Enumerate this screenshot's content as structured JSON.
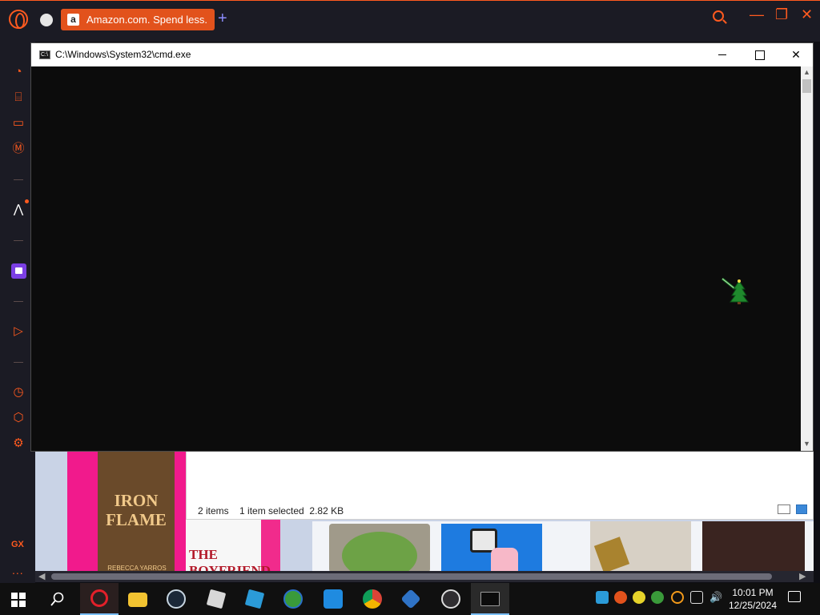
{
  "browser": {
    "tab_title": "Amazon.com. Spend less.",
    "tab_favicon": "a",
    "new_tab_label": "+",
    "accent_color": "#ff5a1f",
    "side_brand": "GX",
    "side_more": "..."
  },
  "cmd": {
    "title": "C:\\Windows\\System32\\cmd.exe",
    "icon_text": "C:\\",
    "close_label": "✕"
  },
  "explorer": {
    "status": "2 items    1 item selected  2.82 KB"
  },
  "books": {
    "book1_title": "IRON FLAME",
    "book1_author": "REBECCA YARROS",
    "book2_title": "THE BOYFRIEND"
  },
  "taskbar": {
    "time": "10:01 PM",
    "date": "12/25/2024",
    "items": [
      "start",
      "search",
      "opera-gx",
      "file-explorer",
      "steam",
      "roblox-studio",
      "roblox",
      "internet-download-manager",
      "anydesk",
      "chrome",
      "virtualbox",
      "obs-studio",
      "cmd"
    ]
  }
}
